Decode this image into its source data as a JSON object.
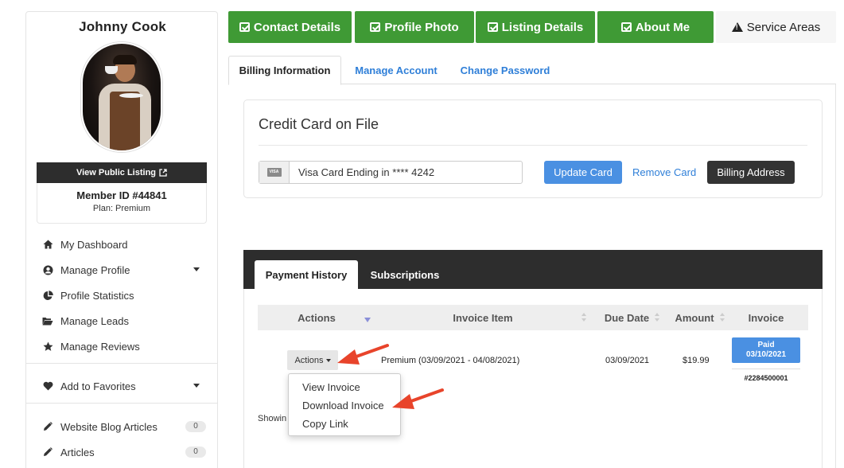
{
  "user": {
    "name": "Johnny Cook",
    "public_listing_label": "View Public Listing",
    "member_id": "Member ID #44841",
    "plan": "Plan: Premium"
  },
  "sidebar": {
    "items": [
      {
        "label": "My Dashboard",
        "icon": "home-icon"
      },
      {
        "label": "Manage Profile",
        "icon": "user-circle-icon"
      },
      {
        "label": "Profile Statistics",
        "icon": "pie-chart-icon"
      },
      {
        "label": "Manage Leads",
        "icon": "folder-open-icon"
      },
      {
        "label": "Manage Reviews",
        "icon": "star-icon"
      },
      {
        "label": "Add to Favorites",
        "icon": "heart-icon"
      },
      {
        "label": "Website Blog Articles",
        "icon": "pencil-icon",
        "count": "0"
      },
      {
        "label": "Articles",
        "icon": "pencil-icon",
        "count": "0"
      }
    ]
  },
  "top_tabs": [
    {
      "label": "Contact Details",
      "status": "complete"
    },
    {
      "label": "Profile Photo",
      "status": "complete"
    },
    {
      "label": "Listing Details",
      "status": "complete"
    },
    {
      "label": "About Me",
      "status": "complete"
    },
    {
      "label": "Service Areas",
      "status": "warning"
    }
  ],
  "sub_tabs": [
    {
      "label": "Billing Information",
      "active": true
    },
    {
      "label": "Manage Account",
      "active": false
    },
    {
      "label": "Change Password",
      "active": false
    }
  ],
  "credit_card": {
    "title": "Credit Card on File",
    "card_brand": "VISA",
    "card_text": "Visa Card Ending in **** 4242",
    "update_label": "Update Card",
    "remove_label": "Remove Card",
    "billing_label": "Billing Address"
  },
  "payment_history": {
    "tabs": [
      {
        "label": "Payment History",
        "active": true
      },
      {
        "label": "Subscriptions",
        "active": false
      }
    ],
    "columns": [
      "Actions",
      "Invoice Item",
      "Due Date",
      "Amount",
      "Invoice"
    ],
    "rows": [
      {
        "actions_label": "Actions",
        "item": "Premium (03/09/2021 - 04/08/2021)",
        "due_date": "03/09/2021",
        "amount": "$19.99",
        "status": "Paid",
        "paid_date": "03/10/2021",
        "invoice_number": "#2284500001"
      }
    ],
    "dropdown": [
      "View Invoice",
      "Download Invoice",
      "Copy Link"
    ],
    "showing_text": "Showin"
  },
  "colors": {
    "tab_green": "#3f9a35",
    "primary_blue": "#4a90e2",
    "link_blue": "#2f7fd8",
    "dark": "#2d2d2d",
    "annotation_arrow": "#e8442b"
  }
}
